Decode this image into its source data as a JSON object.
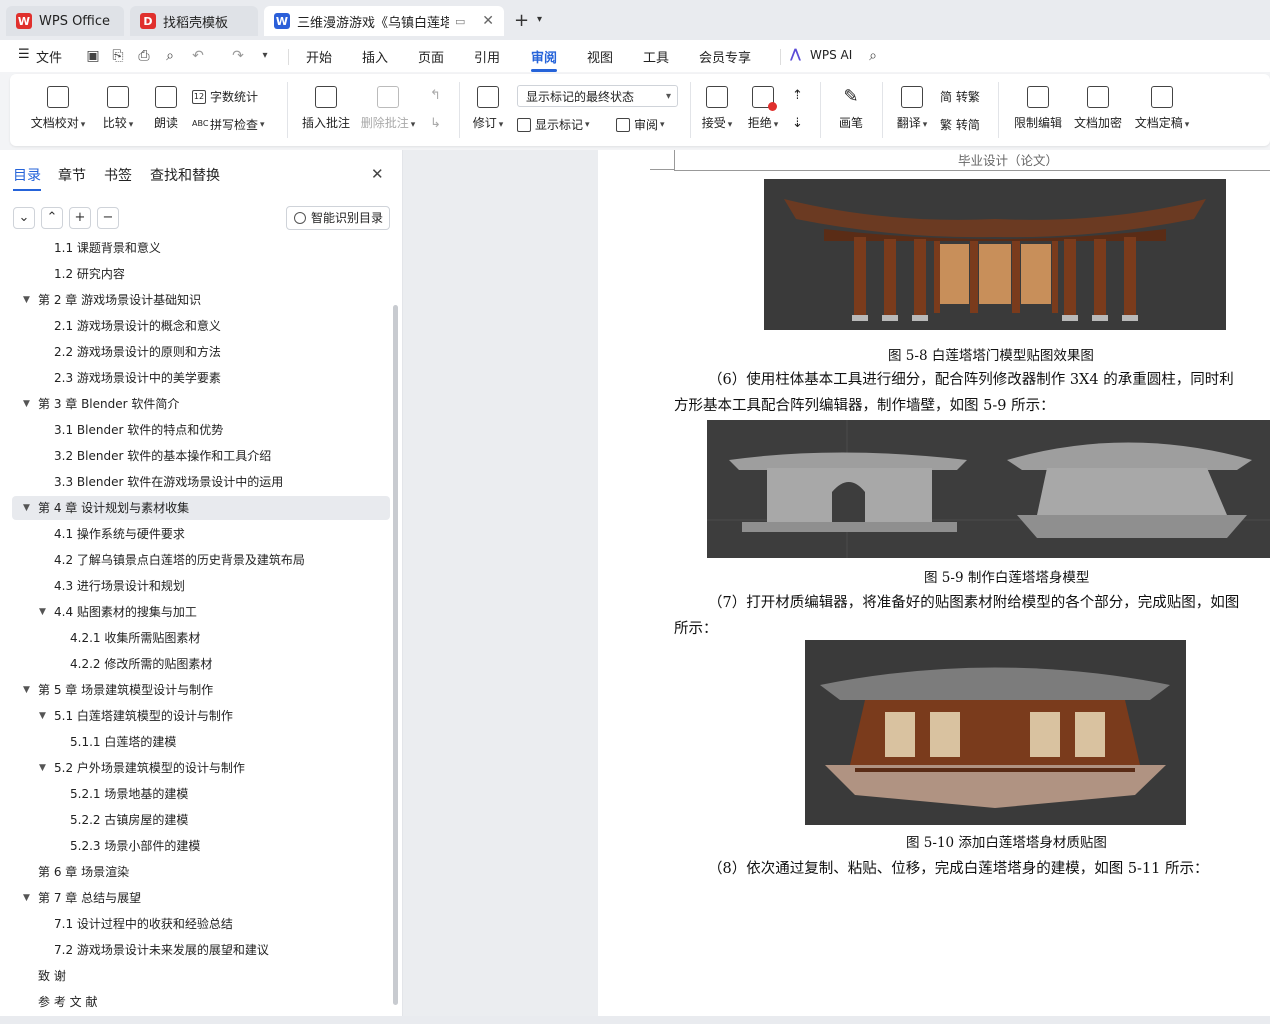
{
  "tabs": [
    {
      "label": "WPS Office",
      "icon": "wps-logo-icon",
      "color": "#e0302d"
    },
    {
      "label": "找稻壳模板",
      "icon": "docer-icon",
      "color": "#e0302d"
    },
    {
      "label": "三维漫游游戏《乌镇白莲塔》",
      "icon": "word-doc-icon",
      "color": "#2b5fd9"
    }
  ],
  "menu": {
    "file": "文件",
    "items": [
      "开始",
      "插入",
      "页面",
      "引用",
      "审阅",
      "视图",
      "工具",
      "会员专享"
    ],
    "active": "审阅",
    "wps_ai": "WPS AI"
  },
  "ribbon": {
    "doc_check": "文档校对",
    "compare": "比较",
    "read_aloud": "朗读",
    "word_count": "字数统计",
    "spell_check": "拼写检查",
    "insert_comment": "插入批注",
    "delete_comment": "删除批注",
    "revise": "修订",
    "mark_state": "显示标记的最终状态",
    "show_marks": "显示标记",
    "review": "审阅",
    "accept": "接受",
    "reject": "拒绝",
    "draw": "画笔",
    "translate": "翻译",
    "to_traditional": "简 转繁",
    "to_simplified": "繁 转简",
    "restrict_edit": "限制编辑",
    "encrypt": "文档加密",
    "finalize": "文档定稿"
  },
  "sidebar": {
    "tabs": [
      "目录",
      "章节",
      "书签",
      "查找和替换"
    ],
    "smart_toc": "智能识别目录",
    "toc": [
      {
        "text": "1.1  课题背景和意义",
        "level": 2,
        "arrow": false
      },
      {
        "text": "1.2 研究内容",
        "level": 2,
        "arrow": false
      },
      {
        "text": "第 2 章  游戏场景设计基础知识",
        "level": 1,
        "arrow": true
      },
      {
        "text": "2.1 游戏场景设计的概念和意义",
        "level": 2,
        "arrow": false
      },
      {
        "text": "2.2 游戏场景设计的原则和方法",
        "level": 2,
        "arrow": false
      },
      {
        "text": "2.3  游戏场景设计中的美学要素",
        "level": 2,
        "arrow": false
      },
      {
        "text": "第 3 章  Blender 软件简介",
        "level": 1,
        "arrow": true
      },
      {
        "text": "3.1 Blender 软件的特点和优势",
        "level": 2,
        "arrow": false
      },
      {
        "text": "3.2 Blender 软件的基本操作和工具介绍",
        "level": 2,
        "arrow": false
      },
      {
        "text": "3.3 Blender 软件在游戏场景设计中的运用",
        "level": 2,
        "arrow": false
      },
      {
        "text": "第 4 章  设计规划与素材收集",
        "level": 1,
        "arrow": true,
        "selected": true
      },
      {
        "text": "4.1  操作系统与硬件要求",
        "level": 2,
        "arrow": false
      },
      {
        "text": "4.2  了解乌镇景点白莲塔的历史背景及建筑布局",
        "level": 2,
        "arrow": false
      },
      {
        "text": "4.3 进行场景设计和规划",
        "level": 2,
        "arrow": false
      },
      {
        "text": "4.4  贴图素材的搜集与加工",
        "level": 2,
        "arrow": true
      },
      {
        "text": "4.2.1 收集所需贴图素材",
        "level": 3,
        "arrow": false
      },
      {
        "text": "4.2.2 修改所需的贴图素材",
        "level": 3,
        "arrow": false
      },
      {
        "text": "第 5 章  场景建筑模型设计与制作",
        "level": 1,
        "arrow": true
      },
      {
        "text": "5.1  白莲塔建筑模型的设计与制作",
        "level": 2,
        "arrow": true
      },
      {
        "text": "5.1.1 白莲塔的建模",
        "level": 3,
        "arrow": false
      },
      {
        "text": "5.2  户外场景建筑模型的设计与制作",
        "level": 2,
        "arrow": true
      },
      {
        "text": "5.2.1 场景地基的建模",
        "level": 3,
        "arrow": false
      },
      {
        "text": "5.2.2 古镇房屋的建模",
        "level": 3,
        "arrow": false
      },
      {
        "text": "5.2.3 场景小部件的建模",
        "level": 3,
        "arrow": false
      },
      {
        "text": "第 6 章  场景渲染",
        "level": 1,
        "arrow": false
      },
      {
        "text": "第 7 章  总结与展望",
        "level": 1,
        "arrow": true
      },
      {
        "text": "7.1  设计过程中的收获和经验总结",
        "level": 2,
        "arrow": false
      },
      {
        "text": "7.2  游戏场景设计未来发展的展望和建议",
        "level": 2,
        "arrow": false
      },
      {
        "text": "致      谢",
        "level": 1,
        "arrow": false
      },
      {
        "text": "参 考 文 献",
        "level": 1,
        "arrow": false
      }
    ]
  },
  "document": {
    "header": "毕业设计（论文）",
    "caption_58": "图 5-8  白莲塔塔门模型贴图效果图",
    "para_6a": "（6）使用柱体基本工具进行细分，配合阵列修改器制作 3X4 的承重圆柱，同时利",
    "para_6b": "方形基本工具配合阵列编辑器，制作墙壁，如图 5-9 所示：",
    "caption_59": "图 5-9  制作白莲塔塔身模型",
    "para_7a": "（7）打开材质编辑器，将准备好的贴图素材附给模型的各个部分，完成贴图，如图",
    "para_7b": "所示：",
    "caption_510": "图 5-10  添加白莲塔塔身材质贴图",
    "para_8": "（8）依次通过复制、粘贴、位移，完成白莲塔塔身的建模，如图 5-11 所示："
  },
  "colors": {
    "accent": "#2563d9",
    "render_bg": "#3a3a3a",
    "wood": "#7a3b1c"
  }
}
